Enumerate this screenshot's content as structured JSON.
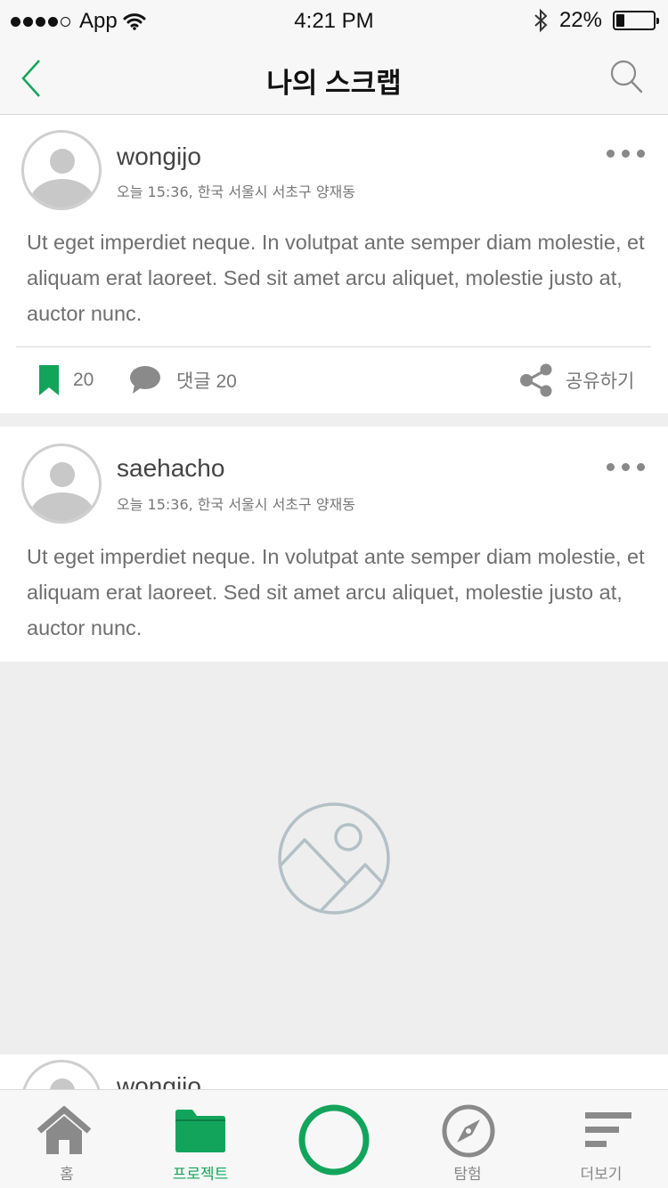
{
  "status_bar": {
    "carrier": "App",
    "time": "4:21 PM",
    "battery_text": "22%",
    "battery_level": 0.22
  },
  "nav": {
    "title": "나의 스크랩",
    "back_icon": "chevron-left-icon",
    "search_icon": "search-icon"
  },
  "posts": [
    {
      "username": "wongijo",
      "meta": "오늘 15:36, 한국 서울시 서초구 양재동",
      "text": "Ut eget imperdiet neque. In volutpat ante semper diam molestie, et aliquam erat laoreet. Sed sit amet arcu aliquet, molestie justo at, auctor nunc.",
      "bookmark_count": "20",
      "comment_label": "댓글 20",
      "share_label": "공유하기"
    },
    {
      "username": "saehacho",
      "meta": "오늘 15:36, 한국 서울시 서초구 양재동",
      "text": "Ut eget imperdiet neque. In volutpat ante semper diam molestie, et aliquam erat laoreet. Sed sit amet arcu aliquet, molestie justo at, auctor nunc."
    },
    {
      "username": "wongijo"
    }
  ],
  "tabs": [
    {
      "label": "홈",
      "icon": "home-icon",
      "active": false
    },
    {
      "label": "프로젝트",
      "icon": "folder-icon",
      "active": true
    },
    {
      "label": "",
      "icon": "record-ring-icon",
      "active": false
    },
    {
      "label": "탐험",
      "icon": "compass-icon",
      "active": false
    },
    {
      "label": "더보기",
      "icon": "menu-lines-icon",
      "active": false
    }
  ],
  "colors": {
    "accent": "#13a45c",
    "gray_icon": "#8a8a8a",
    "placeholder_icon": "#b3c0c6"
  }
}
